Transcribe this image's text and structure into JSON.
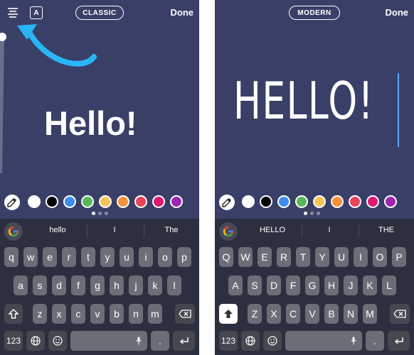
{
  "left": {
    "style_button": "CLASSIC",
    "done_label": "Done",
    "font_badge": "A",
    "canvas_text": "Hello!",
    "suggestions": [
      "hello",
      "I",
      "The"
    ],
    "keys": {
      "row1": [
        "q",
        "w",
        "e",
        "r",
        "t",
        "y",
        "u",
        "i",
        "o",
        "p"
      ],
      "row2": [
        "a",
        "s",
        "d",
        "f",
        "g",
        "h",
        "j",
        "k",
        "l"
      ],
      "row3": [
        "z",
        "x",
        "c",
        "v",
        "b",
        "n",
        "m"
      ],
      "numbers_key": "123"
    }
  },
  "right": {
    "style_button": "MODERN",
    "done_label": "Done",
    "canvas_text": "HELLO!",
    "suggestions": [
      "HELLO",
      "I",
      "THE"
    ],
    "keys": {
      "row1": [
        "Q",
        "W",
        "E",
        "R",
        "T",
        "Y",
        "U",
        "I",
        "O",
        "P"
      ],
      "row2": [
        "A",
        "S",
        "D",
        "F",
        "G",
        "H",
        "J",
        "K",
        "L"
      ],
      "row3": [
        "Z",
        "X",
        "C",
        "V",
        "B",
        "N",
        "M"
      ],
      "numbers_key": "123"
    }
  },
  "colors": {
    "background": "#3a3f67",
    "arrow": "#29b6f6",
    "palette": [
      "#ffffff",
      "#000000",
      "#3d8ef0",
      "#56b85a",
      "#f7c65a",
      "#f7923a",
      "#e8455a",
      "#d81b70",
      "#9b27b0"
    ],
    "page_dots": [
      "#ffffff",
      "#8a8da0",
      "#8a8da0"
    ]
  },
  "icons": {
    "align": "align-lines-icon",
    "font_badge": "font-badge-icon",
    "eyedropper": "eyedropper-icon",
    "google": "google-g-icon",
    "shift": "shift-arrow-icon",
    "backspace": "backspace-icon",
    "globe": "globe-icon",
    "emoji": "emoji-icon",
    "mic": "mic-icon",
    "return": "return-icon"
  }
}
